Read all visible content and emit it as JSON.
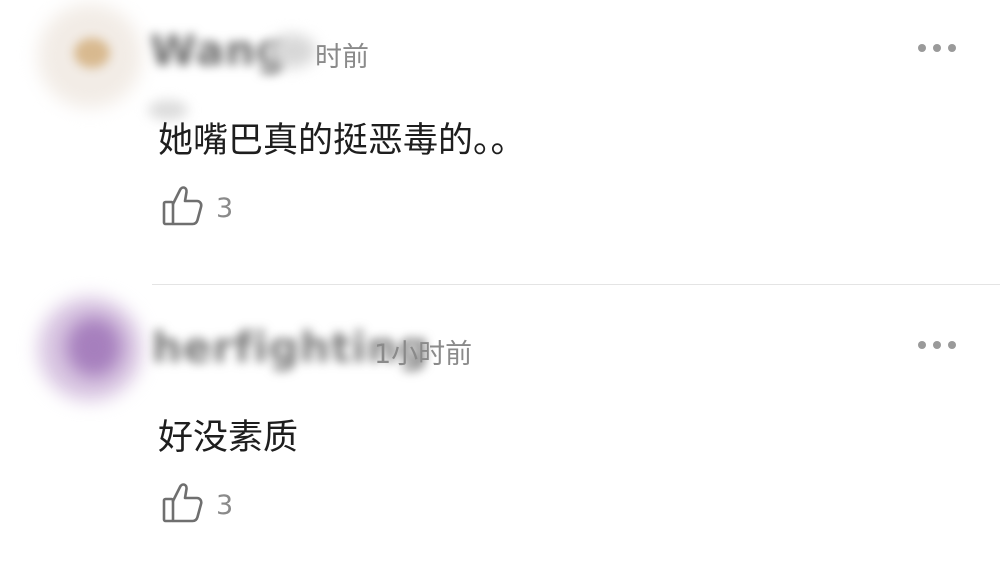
{
  "comments": [
    {
      "username": "Wang",
      "time": "时前",
      "text": "她嘴巴真的挺恶毒的。。",
      "likes": "3",
      "avatar_color": "#efe6dc"
    },
    {
      "username": "herfighting",
      "time": "1小时前",
      "text": "好没素质",
      "likes": "3",
      "avatar_color": "#b99ac8"
    }
  ],
  "icons": {
    "more": "more-dots-icon",
    "like": "thumbs-up-icon"
  }
}
